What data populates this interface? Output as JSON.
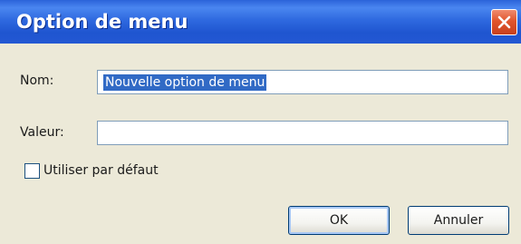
{
  "dialog": {
    "title": "Option de menu",
    "close_icon": "close-icon",
    "colors": {
      "titlebar": "#2f6ae0",
      "close_button": "#e1552c",
      "background": "#ece9d8",
      "selection": "#316ac5"
    }
  },
  "form": {
    "name_label": "Nom:",
    "name_value": "Nouvelle option de menu",
    "value_label": "Valeur:",
    "value_value": "",
    "default_checkbox_label": "Utiliser par défaut",
    "default_checked": false
  },
  "buttons": {
    "ok_label": "OK",
    "cancel_label": "Annuler"
  }
}
